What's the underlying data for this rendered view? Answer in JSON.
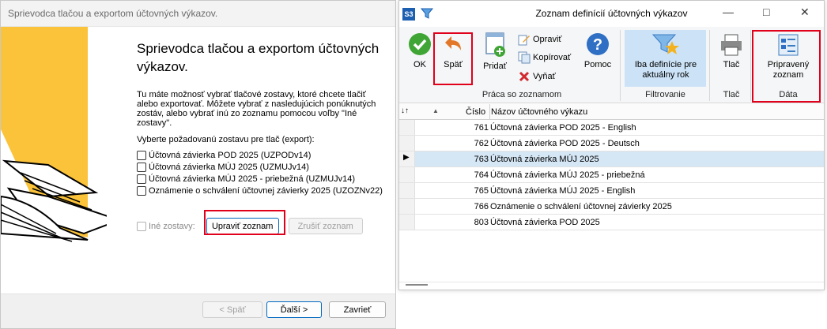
{
  "wizard": {
    "title": "Sprievodca tlačou a exportom účtovných výkazov.",
    "heading": "Sprievodca tlačou a exportom účtovných výkazov.",
    "description": "Tu máte možnosť vybrať tlačové zostavy, ktoré chcete tlačiť alebo exportovať. Môžete vybrať z nasledujúcich ponúknutých zostáv, alebo vybrať inú zo zoznamu pomocou voľby \"Iné zostavy\".",
    "prompt": "Vyberte požadovanú zostavu pre tlač (export):",
    "options": [
      "Účtovná závierka POD 2025 (UZPODv14)",
      "Účtovná závierka MÚJ 2025 (UZMUJv14)",
      "Účtovná závierka MÚJ 2025 - priebežná (UZMUJv14)",
      "Oznámenie o schválení účtovnej závierky 2025 (UZOZNv22)"
    ],
    "other_label": "Iné zostavy:",
    "edit_button": "Upraviť zoznam",
    "cancel_list_button": "Zrušiť zoznam",
    "back_button": "< Späť",
    "next_button": "Ďalší >",
    "close_button": "Zavrieť"
  },
  "list": {
    "app_icon": "S3",
    "title": "Zoznam definícií účtovných výkazov",
    "ribbon": {
      "ok": "OK",
      "back": "Späť",
      "add": "Pridať",
      "edit": "Opraviť",
      "copy": "Kopírovať",
      "cut": "Vyňať",
      "help": "Pomoc",
      "filter": "Iba definície pre aktuálny rok",
      "print": "Tlač",
      "prepared": "Pripravený zoznam",
      "groups": {
        "work": "Práca so zoznamom",
        "filtering": "Filtrovanie",
        "print": "Tlač",
        "data": "Dáta"
      }
    },
    "columns": {
      "number": "Číslo",
      "name": "Názov účtovného výkazu"
    },
    "rows": [
      {
        "number": "761",
        "name": "Účtovná závierka POD 2025 - English"
      },
      {
        "number": "762",
        "name": "Účtovná závierka POD 2025 - Deutsch"
      },
      {
        "number": "763",
        "name": "Účtovná závierka MÚJ 2025"
      },
      {
        "number": "764",
        "name": "Účtovná závierka MÚJ 2025 - priebežná"
      },
      {
        "number": "765",
        "name": "Účtovná závierka MÚJ 2025 - English"
      },
      {
        "number": "766",
        "name": "Oznámenie o schválení účtovnej závierky 2025"
      },
      {
        "number": "803",
        "name": "Účtovná závierka POD 2025"
      }
    ]
  },
  "colors": {
    "highlight": "#e0001b",
    "selected_row": "#d5e6f5",
    "accent": "#0067c0"
  }
}
